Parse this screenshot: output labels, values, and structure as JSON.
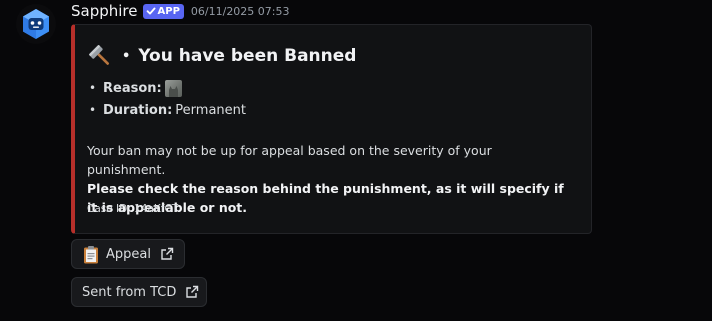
{
  "message": {
    "author": "Sapphire",
    "badge": "APP",
    "timestamp": "06/11/2025 07:53",
    "avatar_icon": "robot-face-icon"
  },
  "embed": {
    "accent_color": "#b62f2a",
    "title_icon": "hammer-icon",
    "title_separator": "•",
    "title": "You have been Banned",
    "fields": [
      {
        "label": "Reason:",
        "value": ""
      },
      {
        "label": "Duration:",
        "value": "Permanent"
      }
    ],
    "description": "Your ban may not be up for appeal based on the severity of your punishment.",
    "description_bold": "Please check the reason behind the punishment, as it will specify if it is appealable or not.",
    "footer": "Case ID: 14aKfCT"
  },
  "buttons": [
    {
      "icon": "clipboard-icon",
      "label": "Appeal",
      "trailing_icon": "external-link-icon"
    },
    {
      "label": "Sent from TCD",
      "trailing_icon": "external-link-icon"
    }
  ]
}
